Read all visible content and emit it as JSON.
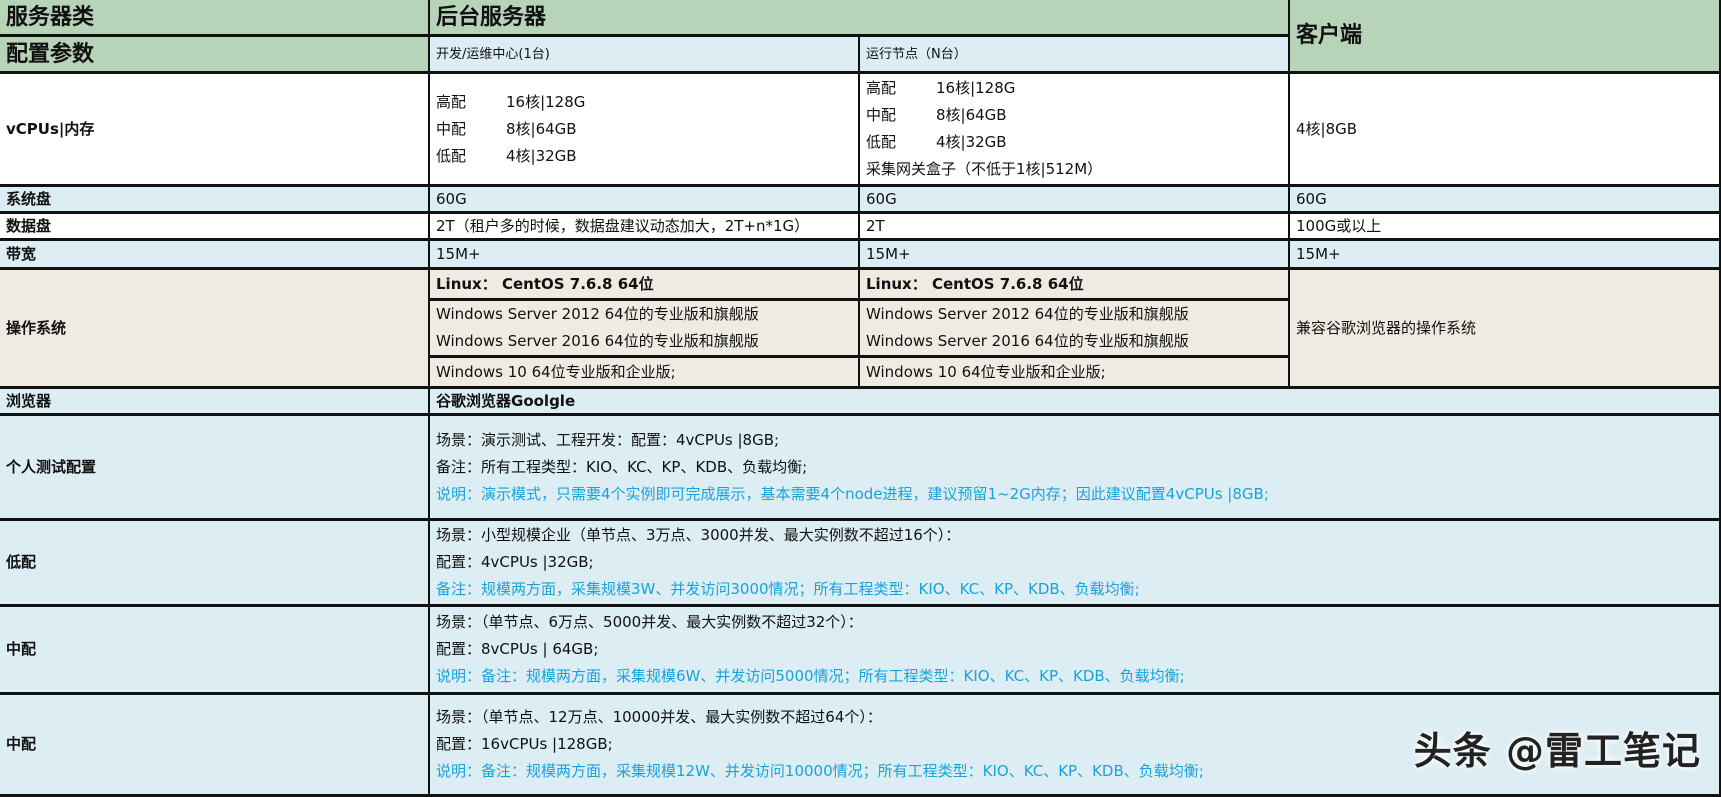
{
  "header": {
    "server_class": "服务器类",
    "backend": "后台服务器",
    "config_params": "配置参数",
    "dev_center": "开发/运维中心(1台)",
    "run_node": "运行节点（N台）",
    "client": "客户端"
  },
  "rows": {
    "vcpu": {
      "label": "vCPUs|内存",
      "dev": [
        {
          "tier": "高配",
          "value": "16核|128G"
        },
        {
          "tier": "中配",
          "value": "8核|64GB"
        },
        {
          "tier": "低配",
          "value": "4核|32GB"
        }
      ],
      "node": [
        {
          "tier": "高配",
          "value": "16核|128G"
        },
        {
          "tier": "中配",
          "value": "8核|64GB"
        },
        {
          "tier": "低配",
          "value": "4核|32GB"
        }
      ],
      "node_extra": "采集网关盒子（不低于1核|512M）",
      "client": "4核|8GB"
    },
    "sysdisk": {
      "label": "系统盘",
      "dev": "60G",
      "node": "60G",
      "client": "60G"
    },
    "datadisk": {
      "label": "数据盘",
      "dev": "2T（租户多的时候，数据盘建议动态加大，2T+n*1G）",
      "node": "2T",
      "client": "100G或以上"
    },
    "bandwidth": {
      "label": "带宽",
      "dev": "15M+",
      "node": "15M+",
      "client": "15M+"
    },
    "os": {
      "label": "操作系统",
      "linux": "Linux： CentOS 7.6.8   64位",
      "win2012": "Windows Server 2012 64位的专业版和旗舰版",
      "win2016": "Windows Server 2016 64位的专业版和旗舰版",
      "win10": "Windows 10  64位专业版和企业版;",
      "client": "兼容谷歌浏览器的操作系统"
    },
    "browser": {
      "label": "浏览器",
      "value": "谷歌浏览器Goolgle"
    },
    "personal": {
      "label": "个人测试配置",
      "lines": [
        "场景：演示测试、工程开发：配置：4vCPUs |8GB;",
        "备注：所有工程类型：KIO、KC、KP、KDB、负载均衡;"
      ],
      "note": "说明：演示模式，只需要4个实例即可完成展示，基本需要4个node进程，建议预留1~2G内存；因此建议配置4vCPUs |8GB;"
    },
    "low": {
      "label": "低配",
      "lines": [
        "场景：小型规模企业（单节点、3万点、3000并发、最大实例数不超过16个）：",
        "配置：4vCPUs |32GB;"
      ],
      "note": "备注：规模两方面，采集规模3W、并发访问3000情况；所有工程类型：KIO、KC、KP、KDB、负载均衡;"
    },
    "mid": {
      "label": "中配",
      "lines": [
        "场景：（单节点、6万点、5000并发、最大实例数不超过32个）：",
        "配置：8vCPUs | 64GB;"
      ],
      "note": "说明：备注：规模两方面，采集规模6W、并发访问5000情况；所有工程类型：KIO、KC、KP、KDB、负载均衡;"
    },
    "high": {
      "label": "中配",
      "lines": [
        "场景：（单节点、12万点、10000并发、最大实例数不超过64个）：",
        "配置：16vCPUs |128GB;"
      ],
      "note": "说明：备注：规模两方面，采集规模12W、并发访问10000情况；所有工程类型：KIO、KC、KP、KDB、负载均衡;"
    }
  },
  "watermark": "头条 @雷工笔记"
}
